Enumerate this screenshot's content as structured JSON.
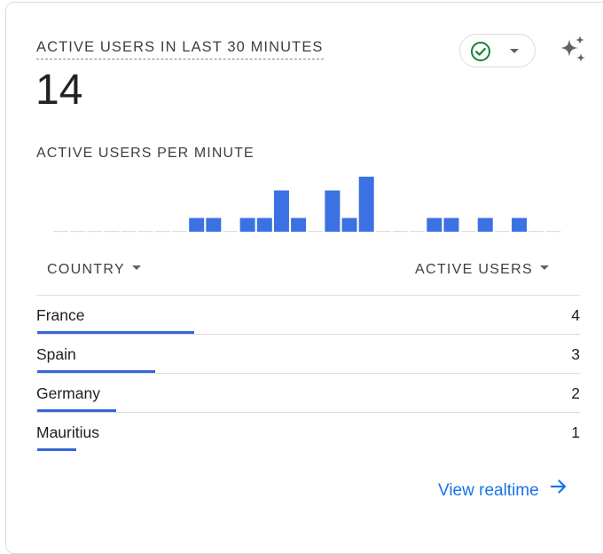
{
  "header": {
    "title": "ACTIVE USERS IN LAST 30 MINUTES",
    "total": "14"
  },
  "controls": {
    "status_icon": "check-circle-icon",
    "status_color": "#188038",
    "insights_icon": "sparkle-icon"
  },
  "chart_data": {
    "type": "bar",
    "title": "ACTIVE USERS PER MINUTE",
    "bar_color": "#3b71e3",
    "baseline_color": "#dadce0",
    "values": [
      0,
      0,
      0,
      0,
      0,
      0,
      0,
      0,
      1,
      1,
      0,
      1,
      1,
      3,
      1,
      0,
      3,
      1,
      4,
      0,
      0,
      0,
      1,
      1,
      0,
      1,
      0,
      1,
      0,
      0
    ]
  },
  "table": {
    "columns": [
      "COUNTRY",
      "ACTIVE USERS"
    ],
    "max_value": 4,
    "rows": [
      {
        "country": "France",
        "users": "4",
        "share": 1.0
      },
      {
        "country": "Spain",
        "users": "3",
        "share": 0.75
      },
      {
        "country": "Germany",
        "users": "2",
        "share": 0.5
      },
      {
        "country": "Mauritius",
        "users": "1",
        "share": 0.25
      }
    ]
  },
  "footer": {
    "link_label": "View realtime",
    "link_icon": "arrow-right-icon",
    "accent": "#1a73e8"
  }
}
